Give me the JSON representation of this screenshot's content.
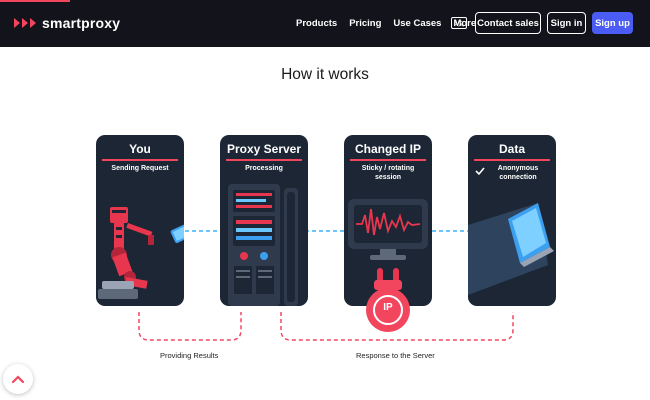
{
  "header": {
    "brand": "smartproxy",
    "nav": [
      "Products",
      "Pricing",
      "Use Cases",
      "More"
    ],
    "lang_icon": "A文",
    "contact_label": "Contact sales",
    "signin_label": "Sign in",
    "signup_label": "Sign up"
  },
  "section": {
    "title": "How it works"
  },
  "cards": [
    {
      "title": "You",
      "subtitle": "Sending Request"
    },
    {
      "title": "Proxy Server",
      "subtitle": "Processing"
    },
    {
      "title": "Changed IP",
      "subtitle": "Sticky / rotating session"
    },
    {
      "title": "Data",
      "subtitle": "Anonymous connection"
    }
  ],
  "ip_badge": "IP",
  "flow_labels": {
    "left": "Providing Results",
    "right": "Response to the Server"
  },
  "colors": {
    "accent": "#f2465f",
    "primary": "#4b5cf5",
    "card_bg": "#1c2634",
    "link_line": "#6bc8ff"
  }
}
